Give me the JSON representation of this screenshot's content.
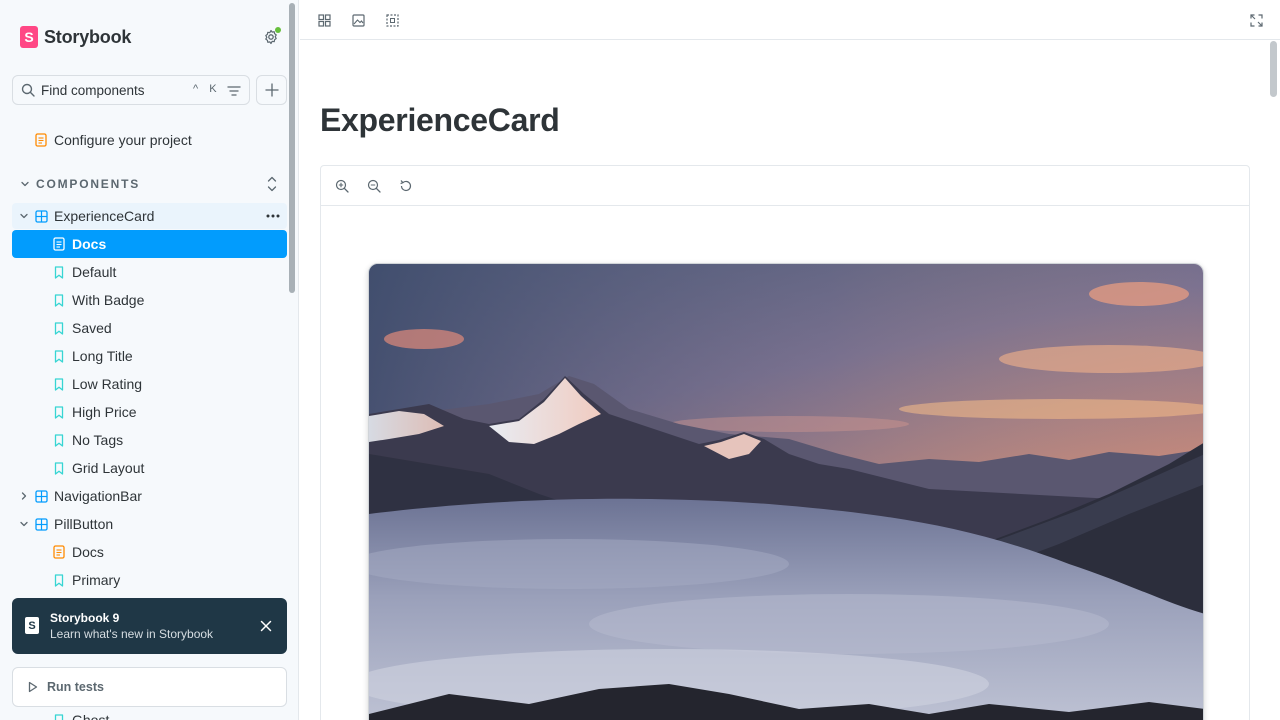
{
  "brand": {
    "name": "Storybook",
    "mark": "S"
  },
  "search": {
    "placeholder": "Find components",
    "shortcut": "^ K"
  },
  "sidebar": {
    "configure_label": "Configure your project",
    "section_label": "COMPONENTS",
    "tree": [
      {
        "label": "ExperienceCard",
        "kind": "component",
        "expanded": true
      },
      {
        "label": "Docs",
        "kind": "docs",
        "selected": true
      },
      {
        "label": "Default",
        "kind": "story"
      },
      {
        "label": "With Badge",
        "kind": "story"
      },
      {
        "label": "Saved",
        "kind": "story"
      },
      {
        "label": "Long Title",
        "kind": "story"
      },
      {
        "label": "Low Rating",
        "kind": "story"
      },
      {
        "label": "High Price",
        "kind": "story"
      },
      {
        "label": "No Tags",
        "kind": "story"
      },
      {
        "label": "Grid Layout",
        "kind": "story"
      },
      {
        "label": "NavigationBar",
        "kind": "component",
        "expanded": false
      },
      {
        "label": "PillButton",
        "kind": "component",
        "expanded": true
      },
      {
        "label": "Docs",
        "kind": "docs"
      },
      {
        "label": "Primary",
        "kind": "story"
      },
      {
        "label": "Ghost",
        "kind": "story"
      }
    ],
    "toast": {
      "title": "Storybook 9",
      "subtitle": "Learn what's new in Storybook"
    },
    "run_tests_label": "Run tests"
  },
  "main": {
    "title": "ExperienceCard"
  },
  "icons": {
    "toolbar": [
      "grid-icon",
      "image-icon",
      "outline-icon",
      "fullscreen-icon"
    ],
    "zoom": [
      "zoom-in-icon",
      "zoom-out-icon",
      "zoom-reset-icon"
    ]
  },
  "colors": {
    "accent": "#029cfd",
    "brand": "#ff4785",
    "component_icon": "#029cfd",
    "docs_icon": "#ff8a00",
    "story_icon": "#37d5d3",
    "toast_bg": "#1f3746"
  }
}
